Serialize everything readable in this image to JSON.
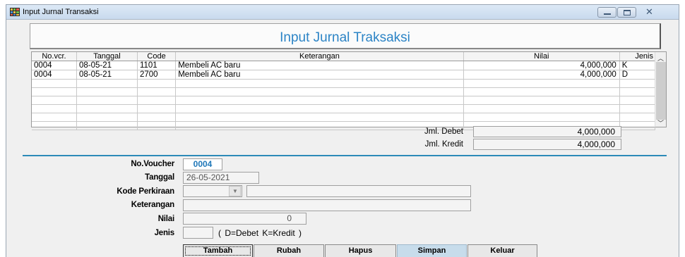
{
  "window": {
    "title": "Input Jurnal Transaksi"
  },
  "header": {
    "title": "Input Jurnal Traksaksi"
  },
  "grid": {
    "columns": [
      "No.vcr.",
      "Tanggal",
      "Code",
      "Keterangan",
      "Nilai",
      "Jenis"
    ],
    "rows": [
      [
        "0004",
        "08-05-21",
        "1101",
        "Membeli AC baru",
        "4,000,000",
        "K"
      ],
      [
        "0004",
        "08-05-21",
        "2700",
        "Membeli AC baru",
        "4,000,000",
        "D"
      ],
      [
        "",
        "",
        "",
        "",
        "",
        ""
      ],
      [
        "",
        "",
        "",
        "",
        "",
        ""
      ],
      [
        "",
        "",
        "",
        "",
        "",
        ""
      ],
      [
        "",
        "",
        "",
        "",
        "",
        ""
      ],
      [
        "",
        "",
        "",
        "",
        "",
        ""
      ],
      [
        "",
        "",
        "",
        "",
        "",
        ""
      ]
    ]
  },
  "totals": {
    "debet_label": "Jml. Debet",
    "debet_value": "4,000,000",
    "kredit_label": "Jml. Kredit",
    "kredit_value": "4,000,000"
  },
  "form": {
    "voucher_label": "No.Voucher",
    "voucher_value": "0004",
    "tanggal_label": "Tanggal",
    "tanggal_value": "26-05-2021",
    "kode_label": "Kode Perkiraan",
    "kode_value": "",
    "kode_name": "",
    "keterangan_label": "Keterangan",
    "keterangan_value": "",
    "nilai_label": "Nilai",
    "nilai_value": "0",
    "jenis_label": "Jenis",
    "jenis_value": "",
    "jenis_hint": "( D=Debet   K=Kredit )"
  },
  "buttons": {
    "tambah": "Tambah",
    "rubah": "Rubah",
    "hapus": "Hapus",
    "simpan": "Simpan",
    "keluar": "Keluar"
  },
  "colors": {
    "accent": "#2c84c6",
    "divider": "#2c8ab8"
  },
  "icons": {
    "app": "app-grid-icon",
    "minimize": "minimize-icon",
    "maximize": "maximize-icon",
    "close": "close-icon"
  }
}
